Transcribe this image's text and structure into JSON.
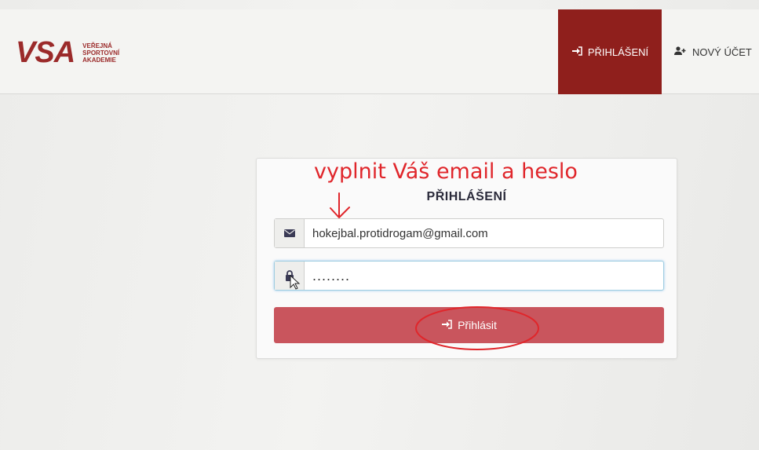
{
  "header": {
    "logo_mark": "VSA",
    "logo_lines": [
      "VEŘEJNÁ",
      "SPORTOVNÍ",
      "AKADEMIE"
    ],
    "nav": {
      "login_label": "PŘIHLÁŠENÍ",
      "login_icon": "sign-in-icon",
      "new_account_label": "NOVÝ ÚČET",
      "new_account_icon": "user-plus-icon"
    }
  },
  "login": {
    "title": "PŘIHLÁŠENÍ",
    "email_value": "hokejbal.protidrogam@gmail.com",
    "email_icon": "envelope-icon",
    "password_value": "........",
    "password_icon": "lock-icon",
    "submit_label": "Přihlásit",
    "submit_icon": "sign-in-icon"
  },
  "annotation": {
    "text": "vyplnit Váš email a heslo"
  },
  "colors": {
    "brand": "#9b2a2a",
    "nav_active": "#8f1f1c",
    "button": "#c9555d",
    "annotation": "#e0262b"
  }
}
